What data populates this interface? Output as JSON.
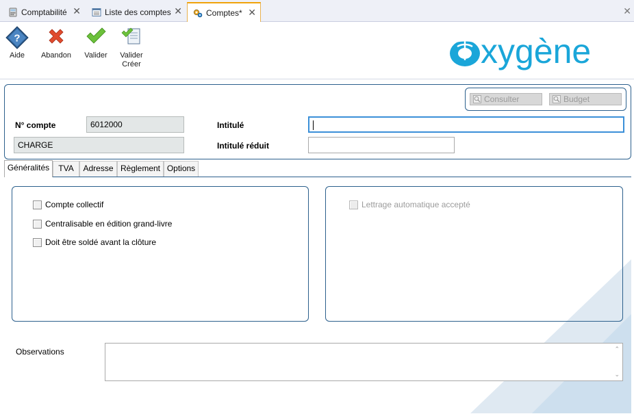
{
  "tabs": [
    {
      "label": "Comptabilité",
      "icon": "calculator-icon",
      "active": false
    },
    {
      "label": "Liste des comptes",
      "icon": "list-window-icon",
      "active": false
    },
    {
      "label": "Comptes*",
      "icon": "gears-icon",
      "active": true
    }
  ],
  "close_glyph": "✕",
  "toolbar": {
    "aide": "Aide",
    "abandon": "Abandon",
    "valider": "Valider",
    "valider_creer_line1": "Valider",
    "valider_creer_line2": "Créer"
  },
  "logo": {
    "text": "xygène",
    "brand_color": "#1aa6d9"
  },
  "header": {
    "consulter": "Consulter",
    "budget": "Budget",
    "num_compte_label": "N° compte",
    "num_compte_value": "6012000",
    "type_value": "CHARGE",
    "intitule_label": "Intitulé",
    "intitule_value": "",
    "intitule_reduit_label": "Intitulé réduit",
    "intitule_reduit_value": ""
  },
  "page_tabs": [
    "Généralités",
    "TVA",
    "Adresse",
    "Règlement",
    "Options"
  ],
  "generalites": {
    "left_checks": [
      {
        "label": "Compte collectif",
        "checked": false
      },
      {
        "label": "Centralisable en édition grand-livre",
        "checked": false
      },
      {
        "label": "Doit être soldé avant la clôture",
        "checked": false
      }
    ],
    "right_checks": [
      {
        "label": "Lettrage automatique accepté",
        "checked": false,
        "disabled": true
      }
    ],
    "observations_label": "Observations",
    "observations_value": ""
  },
  "colors": {
    "accent_border": "#2b5f8c",
    "active_tab": "#f0a30a",
    "focus": "#3a8fd8"
  }
}
